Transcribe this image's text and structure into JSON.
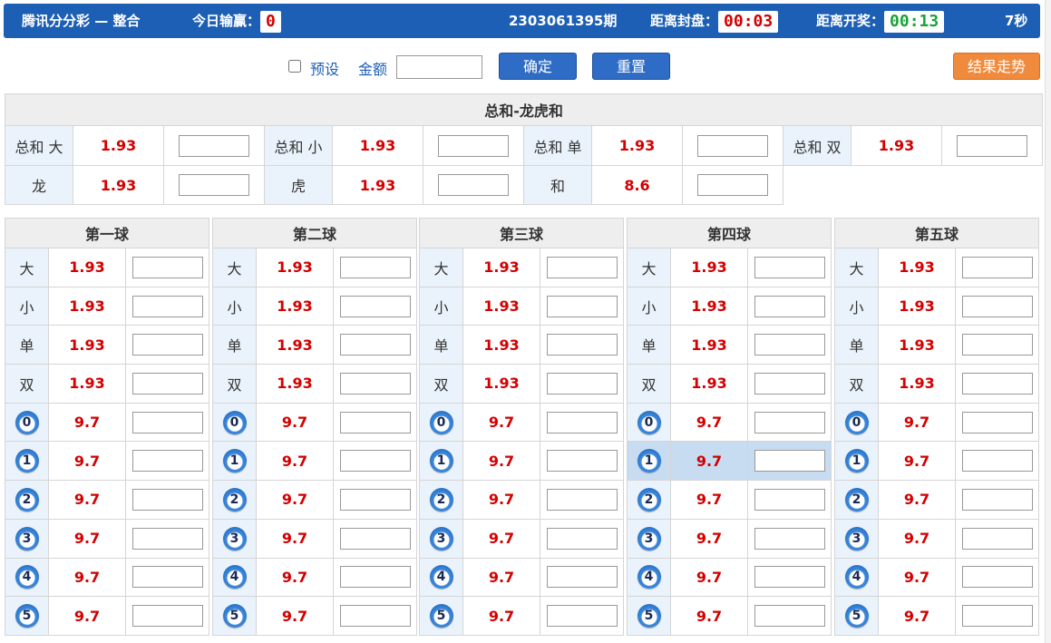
{
  "header": {
    "title": "腾讯分分彩 — 整合",
    "today_label": "今日输赢：",
    "today_value": "0",
    "period": "2303061395期",
    "close_label": "距离封盘：",
    "close_value": "00:03",
    "draw_label": "距离开奖：",
    "draw_value": "00:13",
    "refresh": "7秒"
  },
  "controls": {
    "preset_label": "预设",
    "amount_label": "金额",
    "confirm": "确定",
    "reset": "重置",
    "trend": "结果走势"
  },
  "sum_section": {
    "title": "总和-龙虎和",
    "rows": [
      [
        {
          "name": "总和 大",
          "odds": "1.93"
        },
        {
          "name": "总和 小",
          "odds": "1.93"
        },
        {
          "name": "总和 单",
          "odds": "1.93"
        },
        {
          "name": "总和 双",
          "odds": "1.93"
        }
      ],
      [
        {
          "name": "龙",
          "odds": "1.93"
        },
        {
          "name": "虎",
          "odds": "1.93"
        },
        {
          "name": "和",
          "odds": "8.6"
        }
      ]
    ]
  },
  "balls": [
    {
      "title": "第一球",
      "rows": [
        {
          "name": "大",
          "odds": "1.93"
        },
        {
          "name": "小",
          "odds": "1.93"
        },
        {
          "name": "单",
          "odds": "1.93"
        },
        {
          "name": "双",
          "odds": "1.93"
        },
        {
          "num": "0",
          "odds": "9.7"
        },
        {
          "num": "1",
          "odds": "9.7"
        },
        {
          "num": "2",
          "odds": "9.7"
        },
        {
          "num": "3",
          "odds": "9.7"
        },
        {
          "num": "4",
          "odds": "9.7"
        },
        {
          "num": "5",
          "odds": "9.7"
        }
      ]
    },
    {
      "title": "第二球",
      "rows": [
        {
          "name": "大",
          "odds": "1.93"
        },
        {
          "name": "小",
          "odds": "1.93"
        },
        {
          "name": "单",
          "odds": "1.93"
        },
        {
          "name": "双",
          "odds": "1.93"
        },
        {
          "num": "0",
          "odds": "9.7"
        },
        {
          "num": "1",
          "odds": "9.7"
        },
        {
          "num": "2",
          "odds": "9.7"
        },
        {
          "num": "3",
          "odds": "9.7"
        },
        {
          "num": "4",
          "odds": "9.7"
        },
        {
          "num": "5",
          "odds": "9.7"
        }
      ]
    },
    {
      "title": "第三球",
      "rows": [
        {
          "name": "大",
          "odds": "1.93"
        },
        {
          "name": "小",
          "odds": "1.93"
        },
        {
          "name": "单",
          "odds": "1.93"
        },
        {
          "name": "双",
          "odds": "1.93"
        },
        {
          "num": "0",
          "odds": "9.7"
        },
        {
          "num": "1",
          "odds": "9.7"
        },
        {
          "num": "2",
          "odds": "9.7"
        },
        {
          "num": "3",
          "odds": "9.7"
        },
        {
          "num": "4",
          "odds": "9.7"
        },
        {
          "num": "5",
          "odds": "9.7"
        }
      ]
    },
    {
      "title": "第四球",
      "rows": [
        {
          "name": "大",
          "odds": "1.93"
        },
        {
          "name": "小",
          "odds": "1.93"
        },
        {
          "name": "单",
          "odds": "1.93"
        },
        {
          "name": "双",
          "odds": "1.93"
        },
        {
          "num": "0",
          "odds": "9.7"
        },
        {
          "num": "1",
          "odds": "9.7",
          "highlight": true
        },
        {
          "num": "2",
          "odds": "9.7"
        },
        {
          "num": "3",
          "odds": "9.7"
        },
        {
          "num": "4",
          "odds": "9.7"
        },
        {
          "num": "5",
          "odds": "9.7"
        }
      ]
    },
    {
      "title": "第五球",
      "rows": [
        {
          "name": "大",
          "odds": "1.93"
        },
        {
          "name": "小",
          "odds": "1.93"
        },
        {
          "name": "单",
          "odds": "1.93"
        },
        {
          "name": "双",
          "odds": "1.93"
        },
        {
          "num": "0",
          "odds": "9.7"
        },
        {
          "num": "1",
          "odds": "9.7"
        },
        {
          "num": "2",
          "odds": "9.7"
        },
        {
          "num": "3",
          "odds": "9.7"
        },
        {
          "num": "4",
          "odds": "9.7"
        },
        {
          "num": "5",
          "odds": "9.7"
        }
      ]
    }
  ],
  "colors": {
    "header_blue": "#1d5fb4",
    "odds_red": "#d40000",
    "timer_green": "#1aa33a",
    "trend_orange": "#f08a3c"
  }
}
